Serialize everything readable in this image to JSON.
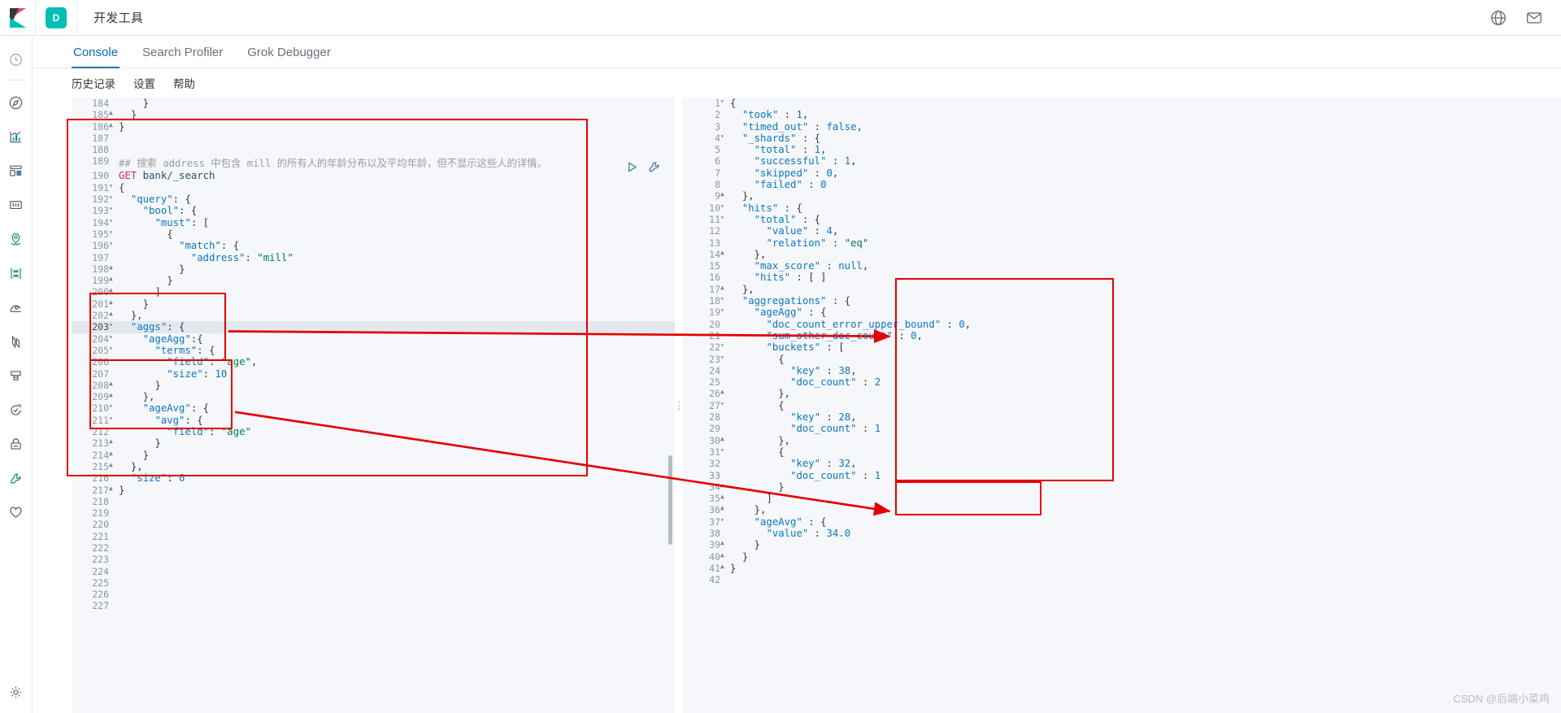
{
  "topbar": {
    "logo_name": "kibana-logo",
    "space_badge": "D",
    "app_title": "开发工具",
    "globe_icon": "globe-icon",
    "mail_icon": "mail-icon"
  },
  "rail": {
    "items": [
      {
        "name": "recently-viewed",
        "icon": "clock-icon"
      },
      {
        "name": "discover",
        "icon": "compass-icon"
      },
      {
        "name": "visualize",
        "icon": "bar-chart-icon"
      },
      {
        "name": "dashboard",
        "icon": "dashboard-icon"
      },
      {
        "name": "canvas",
        "icon": "presentation-icon"
      },
      {
        "name": "maps",
        "icon": "map-marker-icon"
      },
      {
        "name": "machine-learning",
        "icon": "ml-nodes-icon"
      },
      {
        "name": "infrastructure",
        "icon": "infra-icon"
      },
      {
        "name": "logs",
        "icon": "logs-icon"
      },
      {
        "name": "apm",
        "icon": "apm-icon"
      },
      {
        "name": "uptime",
        "icon": "uptime-icon"
      },
      {
        "name": "siem",
        "icon": "lock-icon"
      },
      {
        "name": "dev-tools",
        "icon": "wrench-icon"
      },
      {
        "name": "monitoring",
        "icon": "heart-icon"
      },
      {
        "name": "management",
        "icon": "gear-icon"
      }
    ]
  },
  "tabs": [
    {
      "label": "Console",
      "active": true
    },
    {
      "label": "Search Profiler",
      "active": false
    },
    {
      "label": "Grok Debugger",
      "active": false
    }
  ],
  "submenu": [
    {
      "label": "历史记录"
    },
    {
      "label": "设置"
    },
    {
      "label": "帮助"
    }
  ],
  "editor": {
    "first_line_number": 184,
    "highlight_line": 203,
    "play_icon": "play-icon",
    "wrench_icon": "wrench-icon",
    "lines": [
      {
        "n": 184,
        "fold": "",
        "text": "    }"
      },
      {
        "n": 185,
        "fold": "▲",
        "text": "  }"
      },
      {
        "n": 186,
        "fold": "▲",
        "text": "}"
      },
      {
        "n": 187,
        "fold": "",
        "text": ""
      },
      {
        "n": 188,
        "fold": "",
        "text": ""
      },
      {
        "n": 189,
        "fold": "",
        "text": "## 搜索 address 中包含 mill 的所有人的年龄分布以及平均年龄，但不显示这些人的详情。"
      },
      {
        "n": 190,
        "fold": "",
        "text": "GET bank/_search"
      },
      {
        "n": 191,
        "fold": "▾",
        "text": "{"
      },
      {
        "n": 192,
        "fold": "▾",
        "text": "  \"query\": {"
      },
      {
        "n": 193,
        "fold": "▾",
        "text": "    \"bool\": {"
      },
      {
        "n": 194,
        "fold": "▾",
        "text": "      \"must\": ["
      },
      {
        "n": 195,
        "fold": "▾",
        "text": "        {"
      },
      {
        "n": 196,
        "fold": "▾",
        "text": "          \"match\": {"
      },
      {
        "n": 197,
        "fold": "",
        "text": "            \"address\": \"mill\""
      },
      {
        "n": 198,
        "fold": "▲",
        "text": "          }"
      },
      {
        "n": 199,
        "fold": "▲",
        "text": "        }"
      },
      {
        "n": 200,
        "fold": "▲",
        "text": "      ]"
      },
      {
        "n": 201,
        "fold": "▲",
        "text": "    }"
      },
      {
        "n": 202,
        "fold": "▲",
        "text": "  },"
      },
      {
        "n": 203,
        "fold": "▾",
        "text": "  \"aggs\": {"
      },
      {
        "n": 204,
        "fold": "▾",
        "text": "    \"ageAgg\":{"
      },
      {
        "n": 205,
        "fold": "▾",
        "text": "      \"terms\": {"
      },
      {
        "n": 206,
        "fold": "",
        "text": "        \"field\": \"age\","
      },
      {
        "n": 207,
        "fold": "",
        "text": "        \"size\": 10"
      },
      {
        "n": 208,
        "fold": "▲",
        "text": "      }"
      },
      {
        "n": 209,
        "fold": "▲",
        "text": "    },"
      },
      {
        "n": 210,
        "fold": "▾",
        "text": "    \"ageAvg\": {"
      },
      {
        "n": 211,
        "fold": "▾",
        "text": "      \"avg\": {"
      },
      {
        "n": 212,
        "fold": "",
        "text": "        \"field\": \"age\""
      },
      {
        "n": 213,
        "fold": "▲",
        "text": "      }"
      },
      {
        "n": 214,
        "fold": "▲",
        "text": "    }"
      },
      {
        "n": 215,
        "fold": "▲",
        "text": "  },"
      },
      {
        "n": 216,
        "fold": "",
        "text": "  \"size\": 0"
      },
      {
        "n": 217,
        "fold": "▲",
        "text": "}"
      },
      {
        "n": 218,
        "fold": "",
        "text": ""
      },
      {
        "n": 219,
        "fold": "",
        "text": ""
      },
      {
        "n": 220,
        "fold": "",
        "text": ""
      },
      {
        "n": 221,
        "fold": "",
        "text": ""
      },
      {
        "n": 222,
        "fold": "",
        "text": ""
      },
      {
        "n": 223,
        "fold": "",
        "text": ""
      },
      {
        "n": 224,
        "fold": "",
        "text": ""
      },
      {
        "n": 225,
        "fold": "",
        "text": ""
      },
      {
        "n": 226,
        "fold": "",
        "text": ""
      },
      {
        "n": 227,
        "fold": "",
        "text": ""
      }
    ]
  },
  "output": {
    "lines": [
      {
        "n": 1,
        "fold": "▾",
        "text": "{"
      },
      {
        "n": 2,
        "fold": "",
        "text": "  \"took\" : 1,"
      },
      {
        "n": 3,
        "fold": "",
        "text": "  \"timed_out\" : false,"
      },
      {
        "n": 4,
        "fold": "▾",
        "text": "  \"_shards\" : {"
      },
      {
        "n": 5,
        "fold": "",
        "text": "    \"total\" : 1,"
      },
      {
        "n": 6,
        "fold": "",
        "text": "    \"successful\" : 1,"
      },
      {
        "n": 7,
        "fold": "",
        "text": "    \"skipped\" : 0,"
      },
      {
        "n": 8,
        "fold": "",
        "text": "    \"failed\" : 0"
      },
      {
        "n": 9,
        "fold": "▲",
        "text": "  },"
      },
      {
        "n": 10,
        "fold": "▾",
        "text": "  \"hits\" : {"
      },
      {
        "n": 11,
        "fold": "▾",
        "text": "    \"total\" : {"
      },
      {
        "n": 12,
        "fold": "",
        "text": "      \"value\" : 4,"
      },
      {
        "n": 13,
        "fold": "",
        "text": "      \"relation\" : \"eq\""
      },
      {
        "n": 14,
        "fold": "▲",
        "text": "    },"
      },
      {
        "n": 15,
        "fold": "",
        "text": "    \"max_score\" : null,"
      },
      {
        "n": 16,
        "fold": "",
        "text": "    \"hits\" : [ ]"
      },
      {
        "n": 17,
        "fold": "▲",
        "text": "  },"
      },
      {
        "n": 18,
        "fold": "▾",
        "text": "  \"aggregations\" : {"
      },
      {
        "n": 19,
        "fold": "▾",
        "text": "    \"ageAgg\" : {"
      },
      {
        "n": 20,
        "fold": "",
        "text": "      \"doc_count_error_upper_bound\" : 0,"
      },
      {
        "n": 21,
        "fold": "",
        "text": "      \"sum_other_doc_count\" : 0,"
      },
      {
        "n": 22,
        "fold": "▾",
        "text": "      \"buckets\" : ["
      },
      {
        "n": 23,
        "fold": "▾",
        "text": "        {"
      },
      {
        "n": 24,
        "fold": "",
        "text": "          \"key\" : 38,"
      },
      {
        "n": 25,
        "fold": "",
        "text": "          \"doc_count\" : 2"
      },
      {
        "n": 26,
        "fold": "▲",
        "text": "        },"
      },
      {
        "n": 27,
        "fold": "▾",
        "text": "        {"
      },
      {
        "n": 28,
        "fold": "",
        "text": "          \"key\" : 28,"
      },
      {
        "n": 29,
        "fold": "",
        "text": "          \"doc_count\" : 1"
      },
      {
        "n": 30,
        "fold": "▲",
        "text": "        },"
      },
      {
        "n": 31,
        "fold": "▾",
        "text": "        {"
      },
      {
        "n": 32,
        "fold": "",
        "text": "          \"key\" : 32,"
      },
      {
        "n": 33,
        "fold": "",
        "text": "          \"doc_count\" : 1"
      },
      {
        "n": 34,
        "fold": "▲",
        "text": "        }"
      },
      {
        "n": 35,
        "fold": "▲",
        "text": "      ]"
      },
      {
        "n": 36,
        "fold": "▲",
        "text": "    },"
      },
      {
        "n": 37,
        "fold": "▾",
        "text": "    \"ageAvg\" : {"
      },
      {
        "n": 38,
        "fold": "",
        "text": "      \"value\" : 34.0"
      },
      {
        "n": 39,
        "fold": "▲",
        "text": "    }"
      },
      {
        "n": 40,
        "fold": "▲",
        "text": "  }"
      },
      {
        "n": 41,
        "fold": "▲",
        "text": "}"
      },
      {
        "n": 42,
        "fold": "",
        "text": ""
      }
    ]
  },
  "annotations": {
    "color": "#e50000",
    "boxes": [
      {
        "name": "request-block-box"
      },
      {
        "name": "ageagg-request-box"
      },
      {
        "name": "ageavg-request-box"
      },
      {
        "name": "ageagg-response-box"
      },
      {
        "name": "ageavg-response-box"
      }
    ],
    "arrows": [
      {
        "name": "ageagg-arrow"
      },
      {
        "name": "ageavg-arrow"
      }
    ]
  },
  "watermark": "CSDN @后端小菜鸡"
}
